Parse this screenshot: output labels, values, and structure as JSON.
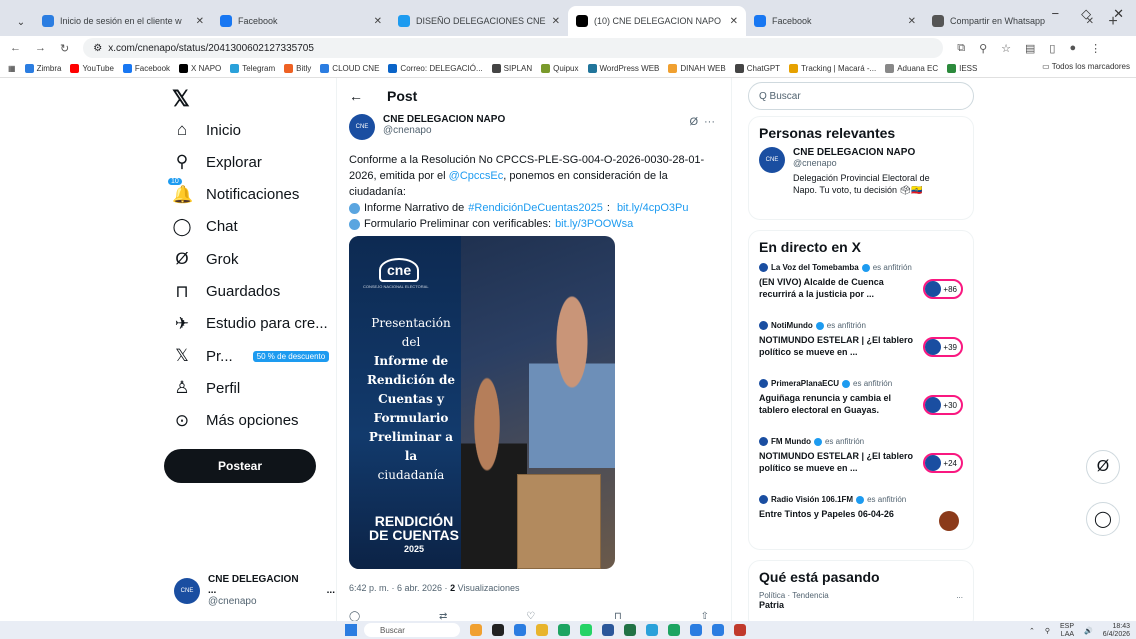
{
  "browser": {
    "tabs": [
      {
        "label": "Inicio de sesión en el cliente w",
        "color": "#2b7de1"
      },
      {
        "label": "Facebook",
        "color": "#1877f2"
      },
      {
        "label": "DISEÑO DELEGACIONES CNE",
        "color": "#1d9bf0"
      },
      {
        "label": "(10) CNE DELEGACION NAPO",
        "color": "#000000",
        "active": true
      },
      {
        "label": "Facebook",
        "color": "#1877f2"
      },
      {
        "label": "Compartir en Whatsapp",
        "color": "#555555"
      }
    ],
    "url": "x.com/cnenapo/status/2041300602127335705",
    "bookmarks": [
      {
        "label": "Zimbra",
        "color": "#2b7de1"
      },
      {
        "label": "YouTube",
        "color": "#ff0000"
      },
      {
        "label": "Facebook",
        "color": "#1877f2"
      },
      {
        "label": "X NAPO",
        "color": "#000000"
      },
      {
        "label": "Telegram",
        "color": "#2aa1da"
      },
      {
        "label": "Bitly",
        "color": "#ee6123"
      },
      {
        "label": "CLOUD CNE",
        "color": "#2b7de1"
      },
      {
        "label": "Correo: DELEGACIÓ...",
        "color": "#0a64c8"
      },
      {
        "label": "SIPLAN",
        "color": "#444444"
      },
      {
        "label": "Quipux",
        "color": "#7a9a2c"
      },
      {
        "label": "WordPress WEB",
        "color": "#21759b"
      },
      {
        "label": "DINAH WEB",
        "color": "#f0a030"
      },
      {
        "label": "ChatGPT",
        "color": "#444444"
      },
      {
        "label": "Tracking | Macará -...",
        "color": "#e6a100"
      },
      {
        "label": "Aduana EC",
        "color": "#888888"
      },
      {
        "label": "IESS",
        "color": "#2c8a3c"
      }
    ],
    "all_bookmarks": "Todos los marcadores"
  },
  "nav": {
    "items": [
      {
        "label": "Inicio",
        "icon": "home-icon",
        "glyph": "⌂"
      },
      {
        "label": "Explorar",
        "icon": "search-icon",
        "glyph": "⚲"
      },
      {
        "label": "Notificaciones",
        "icon": "bell-icon",
        "glyph": "🔔",
        "badge": "10"
      },
      {
        "label": "Chat",
        "icon": "chat-icon",
        "glyph": "◯"
      },
      {
        "label": "Grok",
        "icon": "grok-icon",
        "glyph": "Ø"
      },
      {
        "label": "Guardados",
        "icon": "bookmark-icon",
        "glyph": "⊓"
      },
      {
        "label": "Estudio para cre...",
        "icon": "studio-icon",
        "glyph": "✈"
      },
      {
        "label": "Pr...",
        "icon": "x-premium-icon",
        "glyph": "𝕏",
        "pill": "50 % de descuento"
      },
      {
        "label": "Perfil",
        "icon": "profile-icon",
        "glyph": "♙"
      },
      {
        "label": "Más opciones",
        "icon": "more-icon",
        "glyph": "⊙"
      }
    ],
    "post_button": "Postear",
    "account": {
      "name": "CNE DELEGACION ...",
      "handle": "@cnenapo",
      "more": "..."
    }
  },
  "post": {
    "header": "Post",
    "author_name": "CNE DELEGACION NAPO",
    "author_handle": "@cnenapo",
    "text_1": "Conforme a la Resolución No CPCCS-PLE-SG-004-O-2026-0030-28-01-2026, emitida por el ",
    "mention": "@CpccsEc",
    "text_2": ", ponemos en consideración de la ciudadanía:",
    "line1_text": "Informe Narrativo de ",
    "line1_hashtag": "#RendiciónDeCuentas2025",
    "line1_link": "bit.ly/4cpO3Pu",
    "line2_text": "Formulario Preliminar con verificables: ",
    "line2_link": "bit.ly/3POOWsa",
    "poster": {
      "logo": "cne",
      "logo_sub": "CONSEJO NACIONAL ELECTORAL",
      "lines": [
        "Presentación del",
        "Informe de",
        "Rendición de",
        "Cuentas y",
        "Formulario",
        "Preliminar a la",
        "ciudadanía"
      ],
      "footer1": "RENDICIÓN",
      "footer2": "DE CUENTAS",
      "year": "2025"
    },
    "time": "6:42 p. m. · 6 abr. 2026 · ",
    "views_count": "2",
    "views_label": " Visualizaciones"
  },
  "sidebar": {
    "search_placeholder": "Q Buscar",
    "relevant_title": "Personas relevantes",
    "relevant": {
      "name": "CNE DELEGACION NAPO",
      "handle": "@cnenapo",
      "bio": "Delegación Provincial Electoral de Napo. Tu voto, tu decisión"
    },
    "live_title": "En directo en X",
    "live": [
      {
        "host": "La Voz del Tomebamba",
        "note": "es anfitrión",
        "title": "(EN VIVO) Alcalde de Cuenca recurrirá a la justicia por ...",
        "count": "+86"
      },
      {
        "host": "NotiMundo",
        "note": "es anfitrión",
        "title": "NOTIMUNDO ESTELAR | ¿El tablero político se mueve en ...",
        "count": "+39"
      },
      {
        "host": "PrimeraPlanaECU",
        "note": "es anfitrión",
        "title": "Aguiñaga renuncia y cambia el tablero electoral en Guayas.",
        "count": "+30"
      },
      {
        "host": "FM Mundo",
        "note": "es anfitrión",
        "title": "NOTIMUNDO ESTELAR | ¿El tablero político se mueve en ...",
        "count": "+24"
      },
      {
        "host": "Radio Visión 106.1FM",
        "note": "es anfitrión",
        "title": "Entre Tintos y Papeles 06-04-26",
        "count": ""
      }
    ],
    "trending_title": "Qué está pasando",
    "trend_cat": "Política · Tendencia",
    "trend_name": "Patria",
    "trend_more": "..."
  },
  "taskbar": {
    "search": "Buscar",
    "lang": "ESP",
    "lang2": "LAA",
    "time": "18:43",
    "date": "6/4/2026"
  }
}
